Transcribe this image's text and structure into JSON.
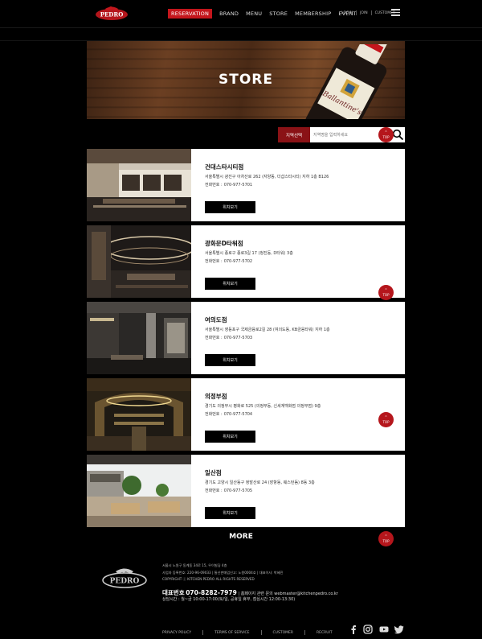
{
  "header": {
    "logo_text": "PEDRO",
    "nav": [
      {
        "label": "RESERVATION",
        "active": true
      },
      {
        "label": "BRAND",
        "active": false
      },
      {
        "label": "MENU",
        "active": false
      },
      {
        "label": "STORE",
        "active": false
      },
      {
        "label": "MEMBERSHIP",
        "active": false
      },
      {
        "label": "EVENT",
        "active": false
      }
    ],
    "util": [
      "LOGIN",
      "JOIN",
      "CUSTOMER"
    ],
    "menu_icon": "hamburger-icon"
  },
  "hero": {
    "title": "STORE",
    "bottle_label": "Ballantine's"
  },
  "search": {
    "region_label": "지역선택",
    "placeholder": "지역명을 입력하세요",
    "icon": "search-icon"
  },
  "top_button": {
    "label": "TOP",
    "icon": "chevron-up-icon"
  },
  "stores": [
    {
      "name": "건대스타시티점",
      "address": "서울특별시 광진구 아차산로 262 (자양동, 더샵스타시티) 지하 1층 B126",
      "tel_label": "전화번호 :",
      "tel": "070-977-5701",
      "button": "위치보기"
    },
    {
      "name": "광화문D타워점",
      "address": "서울특별시 종로구 종로3길 17 (청진동, D타워) 3층",
      "tel_label": "전화번호 :",
      "tel": "070-977-5702",
      "button": "위치보기"
    },
    {
      "name": "여의도점",
      "address": "서울특별시 영등포구 국제금융로2길 28 (여의도동, KB금융타워) 지하 1층",
      "tel_label": "전화번호 :",
      "tel": "070-977-5703",
      "button": "위치보기"
    },
    {
      "name": "의정부점",
      "address": "경기도 의정부시 평화로 525 (의정부동, 신세계백화점 의정부점) 9층",
      "tel_label": "전화번호 :",
      "tel": "070-977-5704",
      "button": "위치보기"
    },
    {
      "name": "일산점",
      "address": "경기도 고양시 일산동구 정발산로 24 (장항동, 웨스턴돔) 8동 3층",
      "tel_label": "전화번호 :",
      "tel": "070-977-5705",
      "button": "위치보기"
    }
  ],
  "more_label": "MORE",
  "footer": {
    "logo_text": "PEDRO",
    "address": "서울시 노원구 동계동 34로 15, 우이빌딩 4층",
    "company": "사업자 등록번호: 220-96-09033 | 통신판매업신고: 노원0004호 | 대표이사: 박혜진",
    "copyright": "COPYRIGHT ⓒ KITCHEN PEDRO ALL RIGHTS RESERVED",
    "phone_label": "대표번호",
    "phone": "070-8282-7979",
    "email_text": "| 홈페이지 관련 문의 webmaster@kitchenpedro.co.kr",
    "hours": "상담시간 : 월~금 10:00-17:00(토/일, 공휴일 휴무, 점심시간 12:00-13:30)",
    "links": [
      "PRIVACY POLICY",
      "TERMS OF SERVICE",
      "CUSTOMER",
      "RECRUIT"
    ],
    "social": [
      "facebook-icon",
      "instagram-icon",
      "youtube-icon",
      "twitter-icon"
    ]
  },
  "colors": {
    "accent": "#c4161c",
    "background": "#000000",
    "card": "#ffffff"
  }
}
